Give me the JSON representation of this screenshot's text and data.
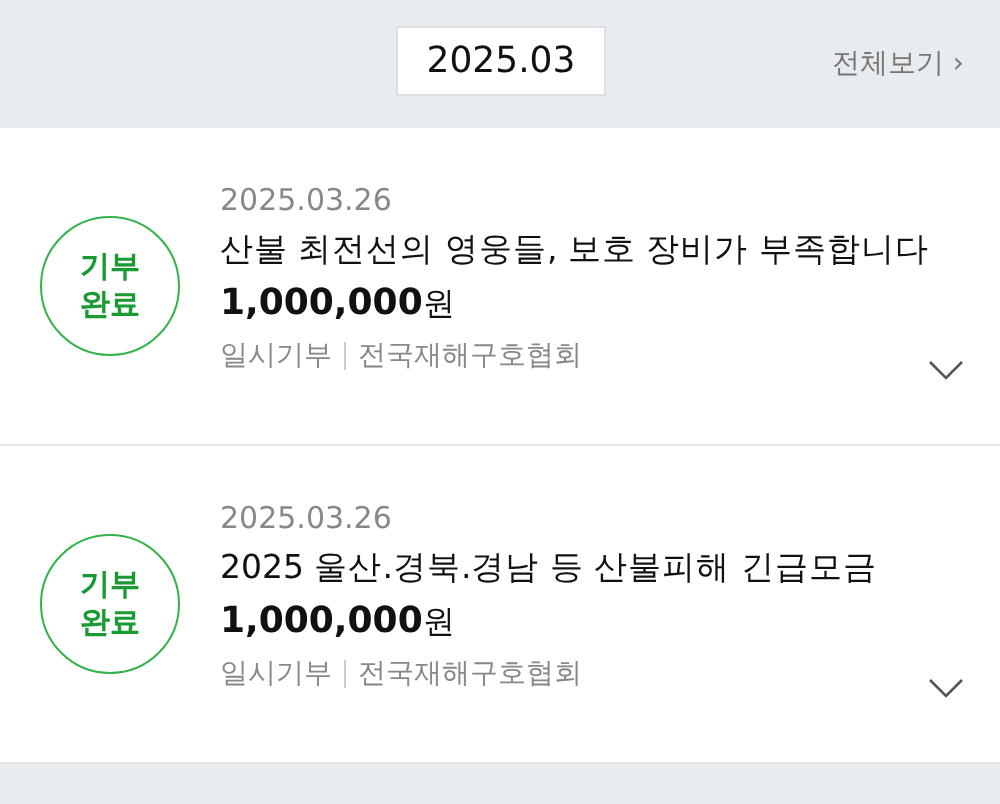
{
  "header": {
    "month": "2025.03",
    "view_all": "전체보기",
    "view_all_arrow": "›"
  },
  "donations": [
    {
      "badge": "기부\n완료",
      "date": "2025.03.26",
      "title": "산불 최전선의 영웅들, 보호 장비가 부족합니다",
      "amount": "1,000,000",
      "unit": "원",
      "type": "일시기부",
      "org": "전국재해구호협회",
      "expanded": false
    },
    {
      "badge": "기부\n완료",
      "date": "2025.03.26",
      "title": "2025 울산.경북.경남 등 산불피해 긴급모금",
      "amount": "1,000,000",
      "unit": "원",
      "type": "일시기부",
      "org": "전국재해구호협회",
      "expanded": false
    }
  ]
}
